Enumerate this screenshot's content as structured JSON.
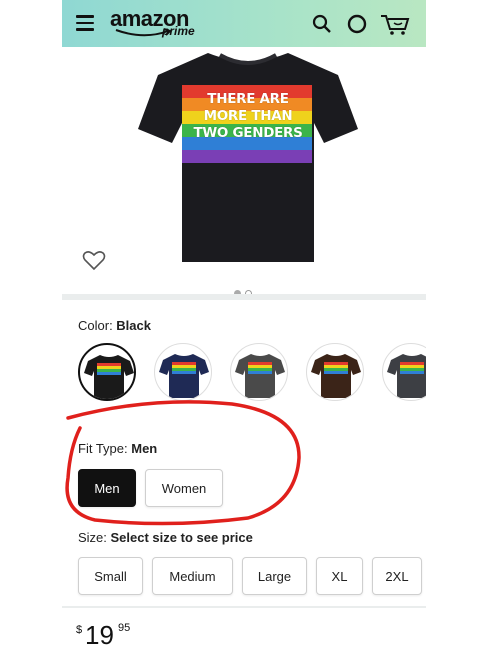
{
  "header": {
    "logo_text": "amazon",
    "logo_sub": "prime",
    "icons": [
      "menu-icon",
      "search-icon",
      "profile-icon",
      "cart-icon"
    ]
  },
  "product": {
    "shirt_text": "THERE ARE MORE THAN TWO GENDERS",
    "shirt_lines": [
      "THERE ARE",
      "MORE THAN",
      "TWO GENDERS"
    ],
    "image_index": 1,
    "image_count": 2
  },
  "color": {
    "label": "Color: ",
    "value": "Black",
    "swatches": [
      {
        "name": "Black",
        "hex": "#1a1a1a"
      },
      {
        "name": "Navy",
        "hex": "#1f2a55"
      },
      {
        "name": "Dark Heather",
        "hex": "#4a4a4a"
      },
      {
        "name": "Brown",
        "hex": "#3b2418"
      },
      {
        "name": "Asphalt",
        "hex": "#3d3f44"
      }
    ]
  },
  "fit": {
    "label": "Fit Type: ",
    "value": "Men",
    "options": [
      "Men",
      "Women"
    ]
  },
  "size": {
    "label": "Size: ",
    "value": "Select size to see price",
    "options": [
      "Small",
      "Medium",
      "Large",
      "XL",
      "2XL"
    ]
  },
  "price": {
    "symbol": "$",
    "whole": "19",
    "fraction": "95"
  },
  "colors": {
    "header_gradient_start": "#8fd8d3",
    "header_gradient_end": "#b9e7c2",
    "annotation_red": "#e0201c",
    "selected_button": "#111111"
  }
}
